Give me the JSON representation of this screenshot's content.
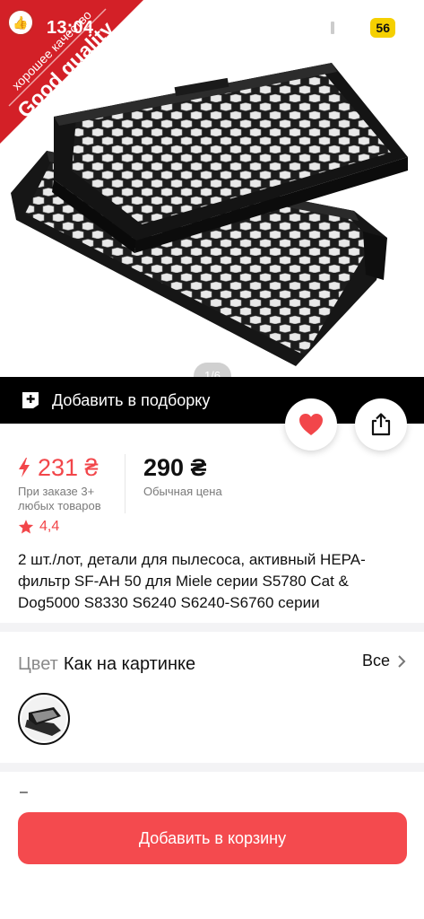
{
  "status_bar": {
    "time": "13:04",
    "battery": "56",
    "icons": [
      "signal-icon",
      "wifi-icon",
      "battery-icon"
    ]
  },
  "banner": {
    "main_text": "Good quality",
    "sub_text": "хорошее качество",
    "color": "#d32027"
  },
  "gallery": {
    "page_indicator": "1/6"
  },
  "collection_bar": {
    "label": "Добавить в подборку",
    "icon": "add-to-collection-icon"
  },
  "actions": {
    "favorite_icon": "heart-icon",
    "share_icon": "share-icon",
    "favorite_color": "#f2464a"
  },
  "price": {
    "sale_value": "231 ₴",
    "sale_caption": "При заказе 3+ любых товаров",
    "regular_value": "290 ₴",
    "regular_caption": "Обычная цена",
    "accent_color": "#f2464a"
  },
  "rating": {
    "value": "4,4"
  },
  "product": {
    "title": "2 шт./лот, детали для пылесоса, активный HEPA-фильтр SF-AH 50 для Miele серии S5780 Cat & Dog5000 S8330 S6240 S6240-S6760 серии"
  },
  "color_option": {
    "label": "Цвет",
    "value": "Как на картинке",
    "all_label": "Все"
  },
  "quantity_dash": "–",
  "cart": {
    "button_label": "Добавить в корзину",
    "color": "#f44a4e"
  }
}
